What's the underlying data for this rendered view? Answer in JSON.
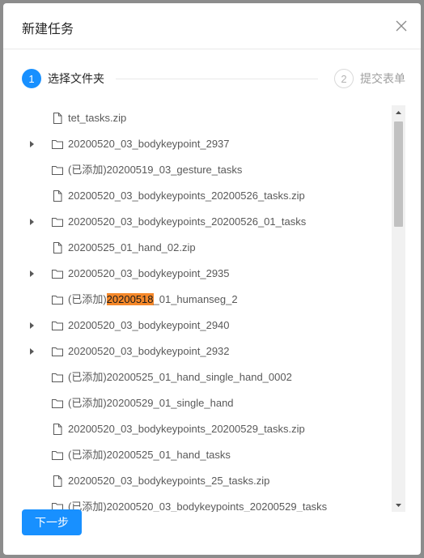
{
  "modal": {
    "title": "新建任务",
    "close_icon": "close-icon"
  },
  "steps": [
    {
      "number": "1",
      "label": "选择文件夹",
      "status": "active"
    },
    {
      "number": "2",
      "label": "提交表单",
      "status": "wait"
    }
  ],
  "tree": {
    "highlight_color": "#f5882a",
    "items": [
      {
        "type": "file",
        "expandable": false,
        "title": "tet_tasks.zip"
      },
      {
        "type": "folder",
        "expandable": true,
        "title": "20200520_03_bodykeypoint_2937"
      },
      {
        "type": "folder",
        "expandable": false,
        "title": "(已添加)20200519_03_gesture_tasks"
      },
      {
        "type": "file",
        "expandable": false,
        "title": "20200520_03_bodykeypoints_20200526_tasks.zip"
      },
      {
        "type": "folder",
        "expandable": true,
        "title": "20200520_03_bodykeypoints_20200526_01_tasks"
      },
      {
        "type": "file",
        "expandable": false,
        "title": "20200525_01_hand_02.zip"
      },
      {
        "type": "folder",
        "expandable": true,
        "title": "20200520_03_bodykeypoint_2935"
      },
      {
        "type": "folder",
        "expandable": false,
        "title_before": "(已添加)",
        "title_highlight": "20200518",
        "title_after": "_01_humanseg_2"
      },
      {
        "type": "folder",
        "expandable": true,
        "title": "20200520_03_bodykeypoint_2940"
      },
      {
        "type": "folder",
        "expandable": true,
        "title": "20200520_03_bodykeypoint_2932"
      },
      {
        "type": "folder",
        "expandable": false,
        "title": "(已添加)20200525_01_hand_single_hand_0002"
      },
      {
        "type": "folder",
        "expandable": false,
        "title": "(已添加)20200529_01_single_hand"
      },
      {
        "type": "file",
        "expandable": false,
        "title": "20200520_03_bodykeypoints_20200529_tasks.zip"
      },
      {
        "type": "folder",
        "expandable": false,
        "title": "(已添加)20200525_01_hand_tasks"
      },
      {
        "type": "file",
        "expandable": false,
        "title": "20200520_03_bodykeypoints_25_tasks.zip"
      },
      {
        "type": "folder",
        "expandable": false,
        "title": "(已添加)20200520_03_bodykeypoints_20200529_tasks"
      }
    ]
  },
  "footer": {
    "next_label": "下一步"
  }
}
